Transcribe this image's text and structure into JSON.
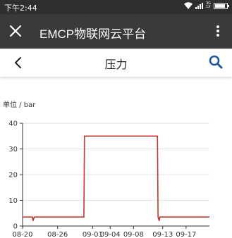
{
  "status_bar": {
    "time": "下午2:44",
    "net_top": "3G",
    "net_bottom": "1X"
  },
  "app_bar": {
    "title": "EMCP物联网云平台",
    "icons": [
      "close-icon",
      "more-vert-icon"
    ]
  },
  "header": {
    "title": "压力",
    "icons": [
      "back-icon",
      "search-icon"
    ]
  },
  "unit_label": "单位 / bar",
  "colors": {
    "status_bar_bg": "#2f2f2f",
    "app_bar_bg": "#3a3a3a",
    "accent": "#1e5a99",
    "series": "#c0392b"
  },
  "chart_data": {
    "type": "line",
    "x_tick_labels": [
      "08-20",
      "08-26",
      "09-01",
      "09-04",
      "09-08",
      "09-13",
      "09-17"
    ],
    "x_tick_days": [
      0,
      6,
      12,
      15,
      19,
      24,
      28
    ],
    "xlim_days": [
      0,
      32
    ],
    "ylim": [
      0,
      40
    ],
    "y_ticks": [
      0,
      10,
      20,
      30,
      40
    ],
    "grid": true,
    "series": [
      {
        "x_days": [
          0,
          1.7,
          1.8,
          2.0,
          2.1,
          10.5,
          10.6,
          23.1,
          23.2,
          23.4,
          23.5,
          32
        ],
        "values": [
          3.5,
          3.5,
          2.0,
          3.5,
          3.5,
          3.5,
          35,
          35,
          3.5,
          2.0,
          3.5,
          3.5
        ]
      }
    ]
  }
}
